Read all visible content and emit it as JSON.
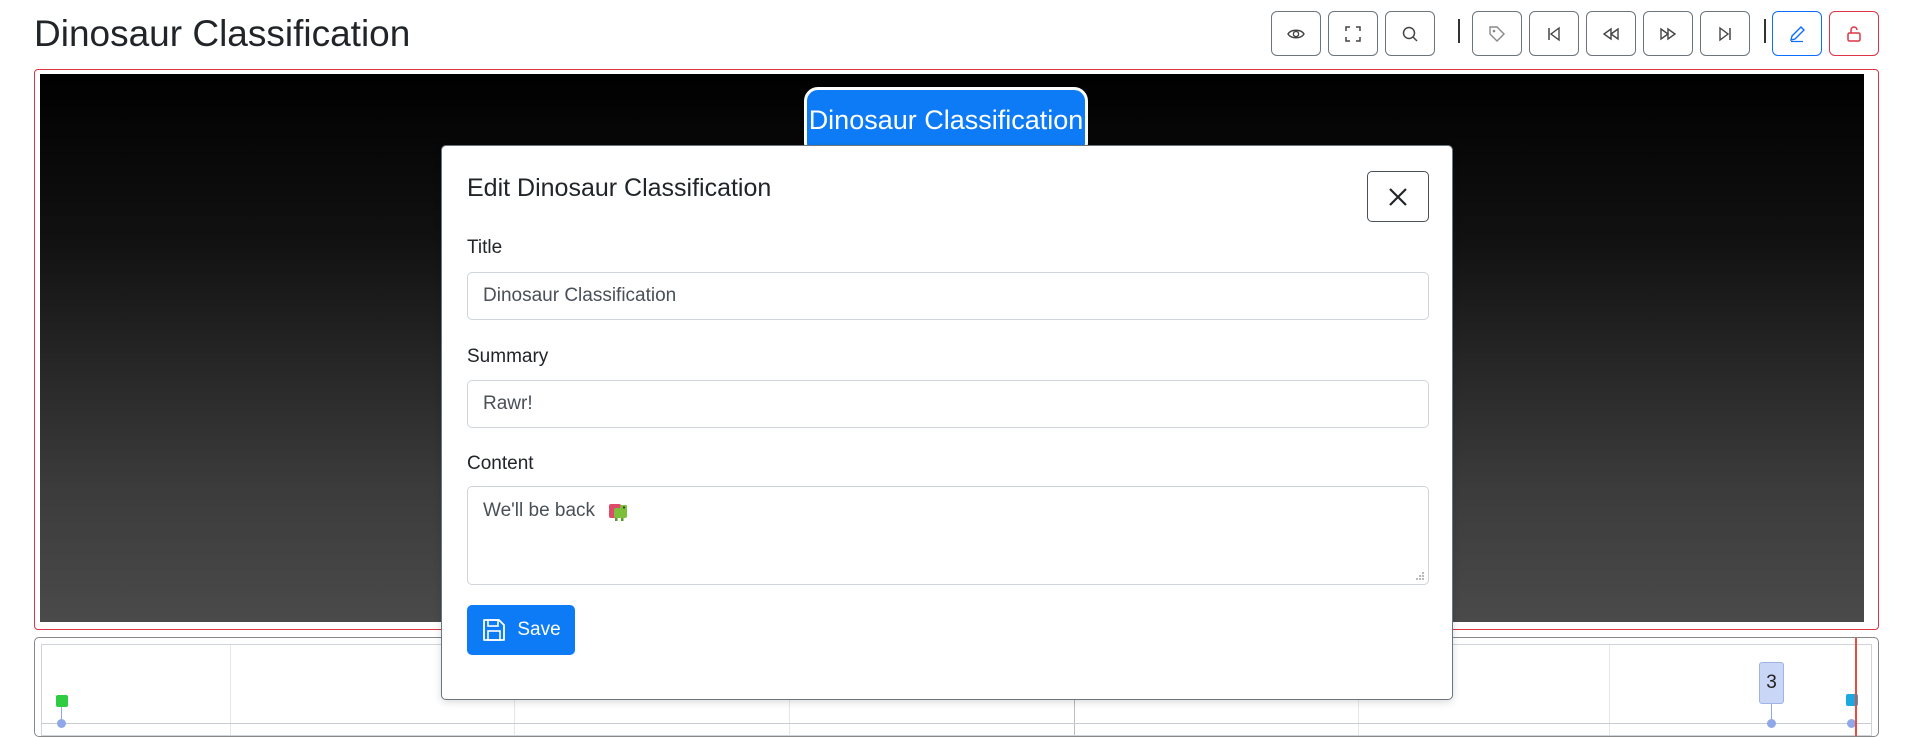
{
  "header": {
    "title": "Dinosaur Classification"
  },
  "toolbar": {
    "buttons": [
      {
        "name": "view",
        "icon": "eye-icon"
      },
      {
        "name": "fullscreen",
        "icon": "fullscreen-icon"
      },
      {
        "name": "search",
        "icon": "search-icon"
      },
      {
        "name": "tag",
        "icon": "tag-icon"
      },
      {
        "name": "first",
        "icon": "skip-start-icon"
      },
      {
        "name": "previous",
        "icon": "rewind-icon"
      },
      {
        "name": "next",
        "icon": "fast-forward-icon"
      },
      {
        "name": "last",
        "icon": "skip-end-icon"
      },
      {
        "name": "edit",
        "icon": "pencil-icon",
        "color": "#0d6efd"
      },
      {
        "name": "lock",
        "icon": "unlock-icon",
        "color": "#dc3545"
      }
    ]
  },
  "story": {
    "slide_title": "Dinosaur Classification"
  },
  "timeline": {
    "event_count": "3",
    "colors": {
      "start_marker": "#2ecc40",
      "end_marker": "#1ea8e0",
      "now_line": "#e74c3c"
    }
  },
  "modal": {
    "title": "Edit Dinosaur Classification",
    "close_icon": "close-icon",
    "fields": {
      "title": {
        "label": "Title",
        "value": "Dinosaur Classification"
      },
      "summary": {
        "label": "Summary",
        "value": "Rawr!"
      },
      "content": {
        "label": "Content",
        "value": "We'll be back",
        "emoji": "dinosaur-emoji"
      }
    },
    "save_label": "Save",
    "save_icon": "floppy-disk-icon"
  },
  "colors": {
    "primary": "#0d7bf5",
    "danger": "#dc3545"
  }
}
